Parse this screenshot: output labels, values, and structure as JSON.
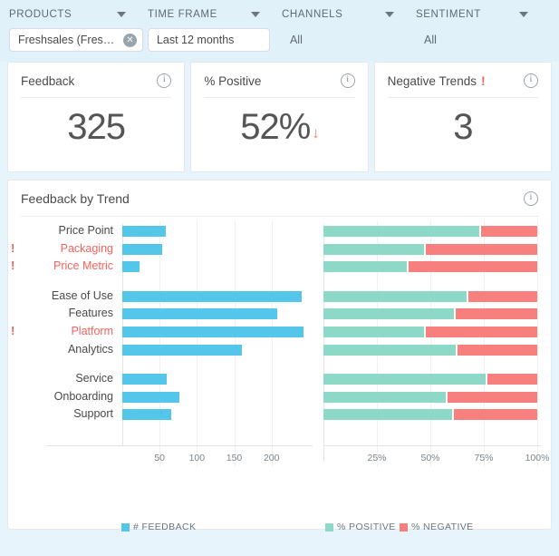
{
  "filters": [
    {
      "label": "PRODUCTS",
      "type": "chip",
      "value": "Freshsales (Fres…)",
      "display": "Freshsales (Fres…",
      "close": "✕"
    },
    {
      "label": "TIME FRAME",
      "type": "select",
      "value": "Last 12 months"
    },
    {
      "label": "CHANNELS",
      "type": "text",
      "value": "All"
    },
    {
      "label": "SENTIMENT",
      "type": "text",
      "value": "All"
    }
  ],
  "kpis": [
    {
      "title": "Feedback",
      "value": "325",
      "alert": false,
      "trend": "",
      "info": "i"
    },
    {
      "title": "% Positive",
      "value": "52%",
      "alert": false,
      "trend": "↓",
      "info": "i"
    },
    {
      "title": "Negative Trends",
      "value": "3",
      "alert": true,
      "alert_mark": "!",
      "trend": "",
      "info": "i"
    }
  ],
  "panel": {
    "title": "Feedback by Trend",
    "info": "i"
  },
  "chart_data": {
    "type": "bar",
    "title": "Feedback by Trend",
    "orientation": "horizontal",
    "categories": [
      "Price Point",
      "Packaging",
      "Price Metric",
      "Ease of Use",
      "Features",
      "Platform",
      "Analytics",
      "Service",
      "Onboarding",
      "Support"
    ],
    "alert_categories": [
      "Packaging",
      "Price Metric",
      "Platform"
    ],
    "alert_marker": "!",
    "groups": [
      [
        "Price Point",
        "Packaging",
        "Price Metric"
      ],
      [
        "Ease of Use",
        "Features",
        "Platform",
        "Analytics"
      ],
      [
        "Service",
        "Onboarding",
        "Support"
      ]
    ],
    "left_panel": {
      "series_name": "# FEEDBACK",
      "values": [
        58,
        53,
        23,
        240,
        208,
        243,
        160,
        59,
        77,
        66
      ],
      "xlim": [
        0,
        255
      ],
      "ticks": [
        50,
        100,
        150,
        200
      ],
      "tick_labels": [
        "50",
        "100",
        "150",
        "200"
      ],
      "color": "#53c6ea"
    },
    "right_panel": {
      "stacked": true,
      "series": [
        {
          "name": "% POSITIVE",
          "color": "#8ed8c7",
          "values": [
            73,
            47,
            39,
            67,
            61,
            47,
            62,
            76,
            57,
            60
          ]
        },
        {
          "name": "% NEGATIVE",
          "color": "#f7807f",
          "values": [
            27,
            53,
            61,
            33,
            39,
            53,
            38,
            24,
            43,
            40
          ]
        }
      ],
      "xlim": [
        0,
        100
      ],
      "ticks": [
        25,
        50,
        75,
        100
      ],
      "tick_labels": [
        "25%",
        "50%",
        "75%",
        "100%"
      ]
    },
    "legend": [
      {
        "label": "# FEEDBACK",
        "color": "#53c6ea"
      },
      {
        "label": "% POSITIVE",
        "color": "#8ed8c7"
      },
      {
        "label": "% NEGATIVE",
        "color": "#f7807f"
      }
    ],
    "grid": true,
    "legend_position": "bottom"
  }
}
